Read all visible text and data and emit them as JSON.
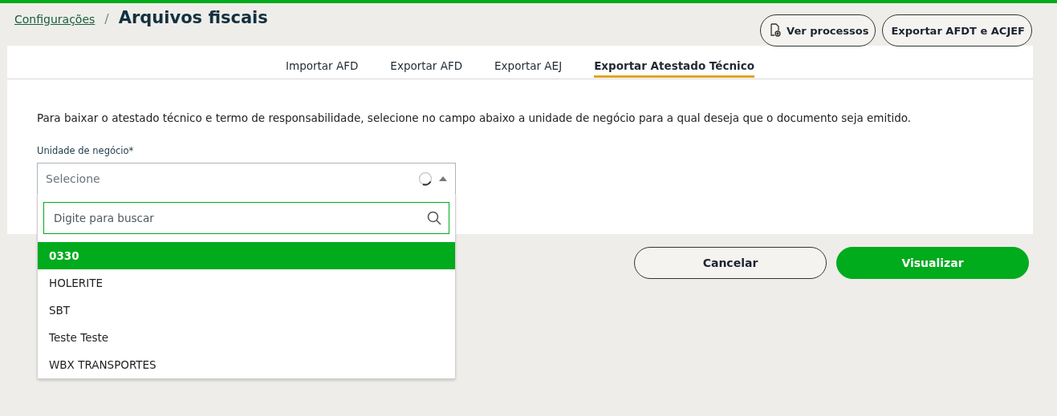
{
  "breadcrumb": {
    "parent": "Configurações",
    "separator": "/",
    "title": "Arquivos fiscais"
  },
  "header_buttons": [
    {
      "label": "Ver processos",
      "kind": "icon"
    },
    {
      "label": "Exportar AFDT e ACJEF",
      "kind": "plain"
    }
  ],
  "tabs": [
    {
      "label": "Importar AFD",
      "selected": false
    },
    {
      "label": "Exportar AFD",
      "selected": false
    },
    {
      "label": "Exportar AEJ",
      "selected": false
    },
    {
      "label": "Exportar Atestado Técnico",
      "selected": true
    }
  ],
  "description": "Para baixar o atestado técnico e termo de responsabilidade, selecione no campo abaixo a unidade de negócio para a qual deseja que o documento seja emitido.",
  "field": {
    "label": "Unidade de negócio*",
    "placeholder": "Selecione",
    "loading": true,
    "expanded": true,
    "search": {
      "placeholder": "Digite para buscar"
    },
    "options": [
      {
        "label": "0330",
        "selected": true
      },
      {
        "label": "HOLERITE",
        "selected": false
      },
      {
        "label": "SBT",
        "selected": false
      },
      {
        "label": "Teste Teste",
        "selected": false
      },
      {
        "label": "WBX TRANSPORTES",
        "selected": false
      }
    ]
  },
  "actions": [
    {
      "label": "Cancelar",
      "kind": "secondary"
    },
    {
      "label": "Visualizar",
      "kind": "primary"
    }
  ]
}
